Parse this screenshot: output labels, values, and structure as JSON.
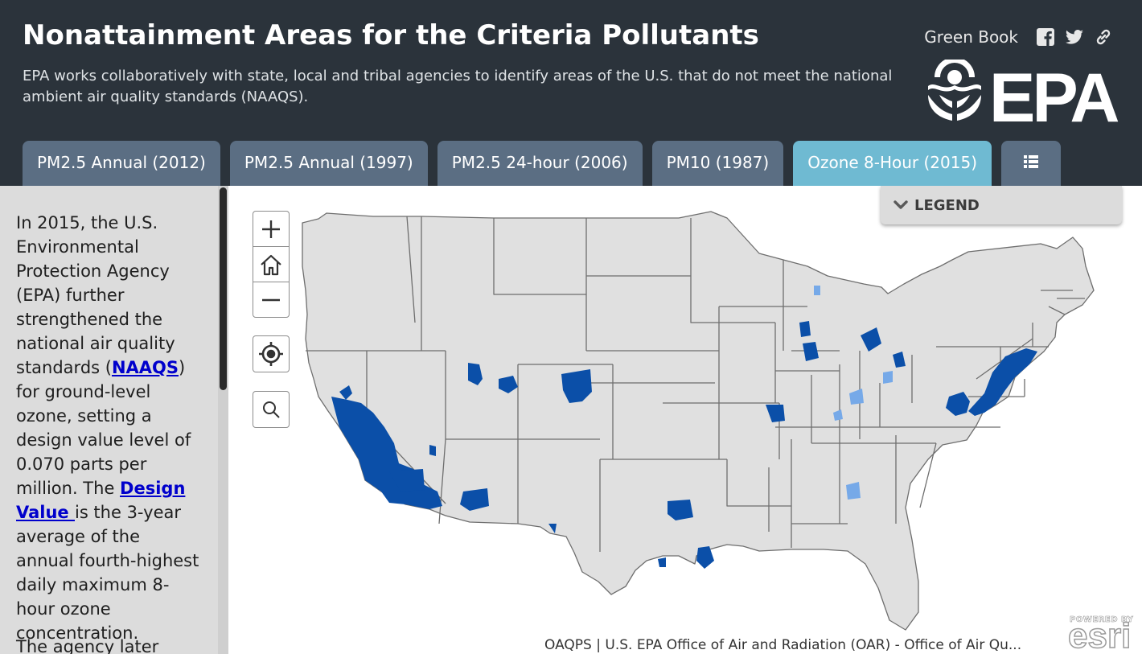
{
  "header": {
    "title": "Nonattainment Areas for the Criteria Pollutants",
    "subtitle": "EPA works collaboratively with state, local and tribal agencies to identify areas of the U.S. that do not meet the national ambient air quality standards (NAAQS).",
    "green_book_link": "Green Book",
    "share_icons": [
      "facebook-icon",
      "twitter-icon",
      "link-icon"
    ],
    "logo_text": "EPA"
  },
  "tabs": [
    {
      "label": "PM2.5 Annual (2012)",
      "active": false
    },
    {
      "label": "PM2.5 Annual (1997)",
      "active": false
    },
    {
      "label": "PM2.5 24-hour (2006)",
      "active": false
    },
    {
      "label": "PM10 (1987)",
      "active": false
    },
    {
      "label": "Ozone 8-Hour (2015)",
      "active": true
    },
    {
      "label": "",
      "icon": "list-icon",
      "active": false
    }
  ],
  "sidebar": {
    "p1_before_link": "In 2015, the U.S. Environmental Protection Agency (EPA) further strengthened the national air quality standards (",
    "link_naaqs": "NAAQS",
    "p1_middle": ") for ground-level ozone, setting a design value level of 0.070 parts per million. The ",
    "link_design_value": "Design Value ",
    "p1_after": "is the 3-year average of the annual fourth-highest daily maximum 8-hour ozone concentration.",
    "p2_start": "The agency later"
  },
  "map": {
    "controls": [
      "zoom-in-icon",
      "home-icon",
      "zoom-out-icon",
      "locate-icon",
      "search-icon"
    ],
    "legend_label": "LEGEND",
    "attribution": "OAQPS | U.S. EPA Office of Air and Radiation (OAR) - Office of Air Qu...",
    "esri_powered": "POWERED BY",
    "esri_word": "esri",
    "colors": {
      "state_fill": "#e0e0e0",
      "state_border": "#6e6e6e",
      "nonattainment_dark": "#0b4fa8",
      "nonattainment_light": "#76a9e8"
    }
  },
  "colors": {
    "header_bg": "#2b333b",
    "tab_bg": "#5b6e83",
    "tab_active_bg": "#6fbad2",
    "sidebar_bg": "#dcdcdc",
    "link": "#0000cc"
  }
}
